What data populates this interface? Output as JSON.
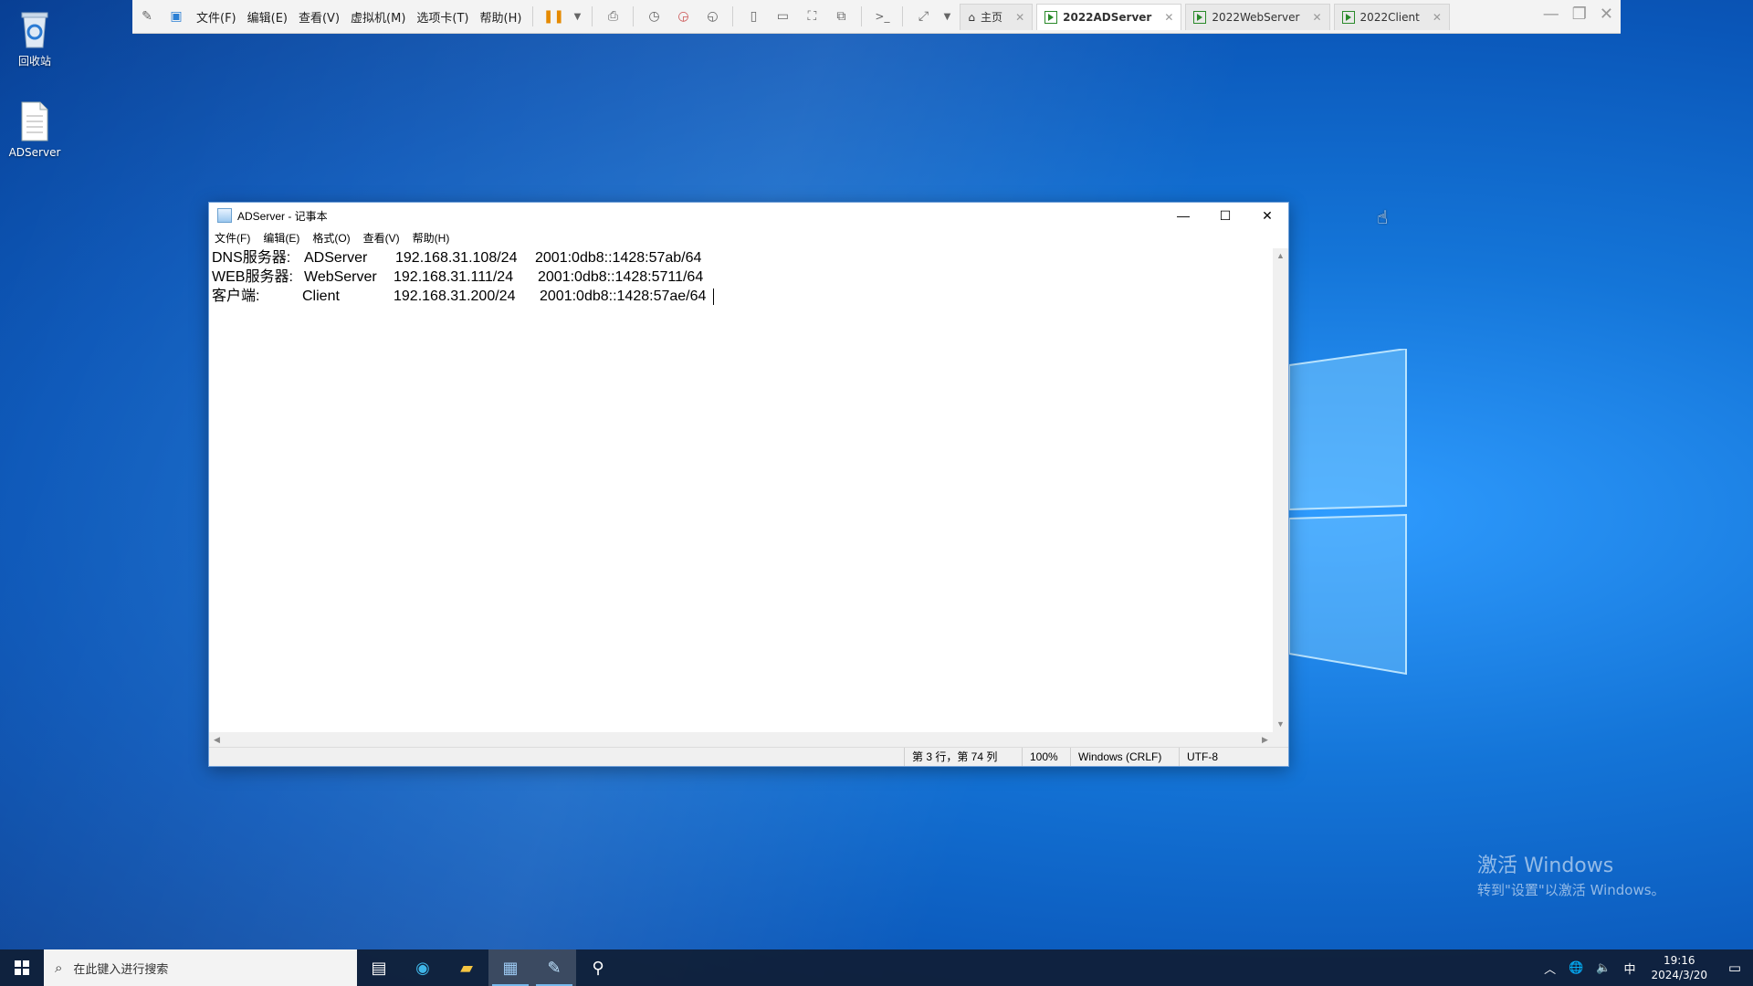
{
  "desktop": {
    "recycle_bin_label": "回收站",
    "file_label": "ADServer"
  },
  "vmware": {
    "menu": [
      "文件(F)",
      "编辑(E)",
      "查看(V)",
      "虚拟机(M)",
      "选项卡(T)",
      "帮助(H)"
    ],
    "tabs": [
      {
        "label": "主页"
      },
      {
        "label": "2022ADServer"
      },
      {
        "label": "2022WebServer"
      },
      {
        "label": "2022Client"
      }
    ]
  },
  "notepad": {
    "title": "ADServer - 记事本",
    "menu": [
      "文件(F)",
      "编辑(E)",
      "格式(O)",
      "查看(V)",
      "帮助(H)"
    ],
    "lines": [
      {
        "role": "DNS服务器:",
        "host": "ADServer",
        "ipv4": "192.168.31.108/24",
        "ipv6": "2001:0db8::1428:57ab/64"
      },
      {
        "role": "WEB服务器:",
        "host": "WebServer",
        "ipv4": "192.168.31.111/24",
        "ipv6": "2001:0db8::1428:5711/64"
      },
      {
        "role": "客户端:",
        "host": "Client",
        "ipv4": "192.168.31.200/24",
        "ipv6": "2001:0db8::1428:57ae/64"
      }
    ],
    "status": {
      "position": "第 3 行，第 74 列",
      "zoom": "100%",
      "line_ending": "Windows (CRLF)",
      "encoding": "UTF-8"
    }
  },
  "watermark": {
    "line1": "激活 Windows",
    "line2": "转到\"设置\"以激活 Windows。"
  },
  "taskbar": {
    "search_placeholder": "在此键入进行搜索",
    "ime": "中",
    "time": "19:16",
    "date": "2024/3/20"
  }
}
